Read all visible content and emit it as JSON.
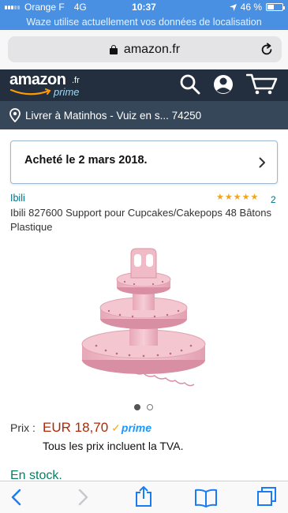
{
  "status_bar": {
    "carrier": "Orange F",
    "network": "4G",
    "time": "10:37",
    "battery": "46 %",
    "battery_level": 0.46
  },
  "location_banner": "Waze utilise actuellement vos données de localisation",
  "browser": {
    "url": "amazon.fr"
  },
  "header": {
    "logo_word": "amazon",
    "logo_suffix": ".fr",
    "logo_sub": "prime"
  },
  "delivery": {
    "text": "Livrer à Matinhos - Vuiz en s... 74250"
  },
  "purchase_notice": "Acheté le 2 mars 2018.",
  "product": {
    "brand": "Ibili",
    "rating_stars": 5,
    "rating_count": "2",
    "title": "Ibili 827600 Support pour Cupcakes/Cakepops 48 Bâtons Plastique",
    "image_count": 2,
    "active_image": 1,
    "price_label": "Prix :",
    "price": "EUR 18,70",
    "prime_label": "prime",
    "vat_note": "Tous les prix incluent la TVA.",
    "stock": "En stock."
  },
  "colors": {
    "status_blue": "#4a90e2",
    "amazon_dark": "#232f3e",
    "location_bar": "#37475a",
    "link": "#007185",
    "price": "#b12704",
    "prime_blue": "#1a98ff",
    "in_stock": "#067d62",
    "ios_blue": "#1a7cf5"
  }
}
